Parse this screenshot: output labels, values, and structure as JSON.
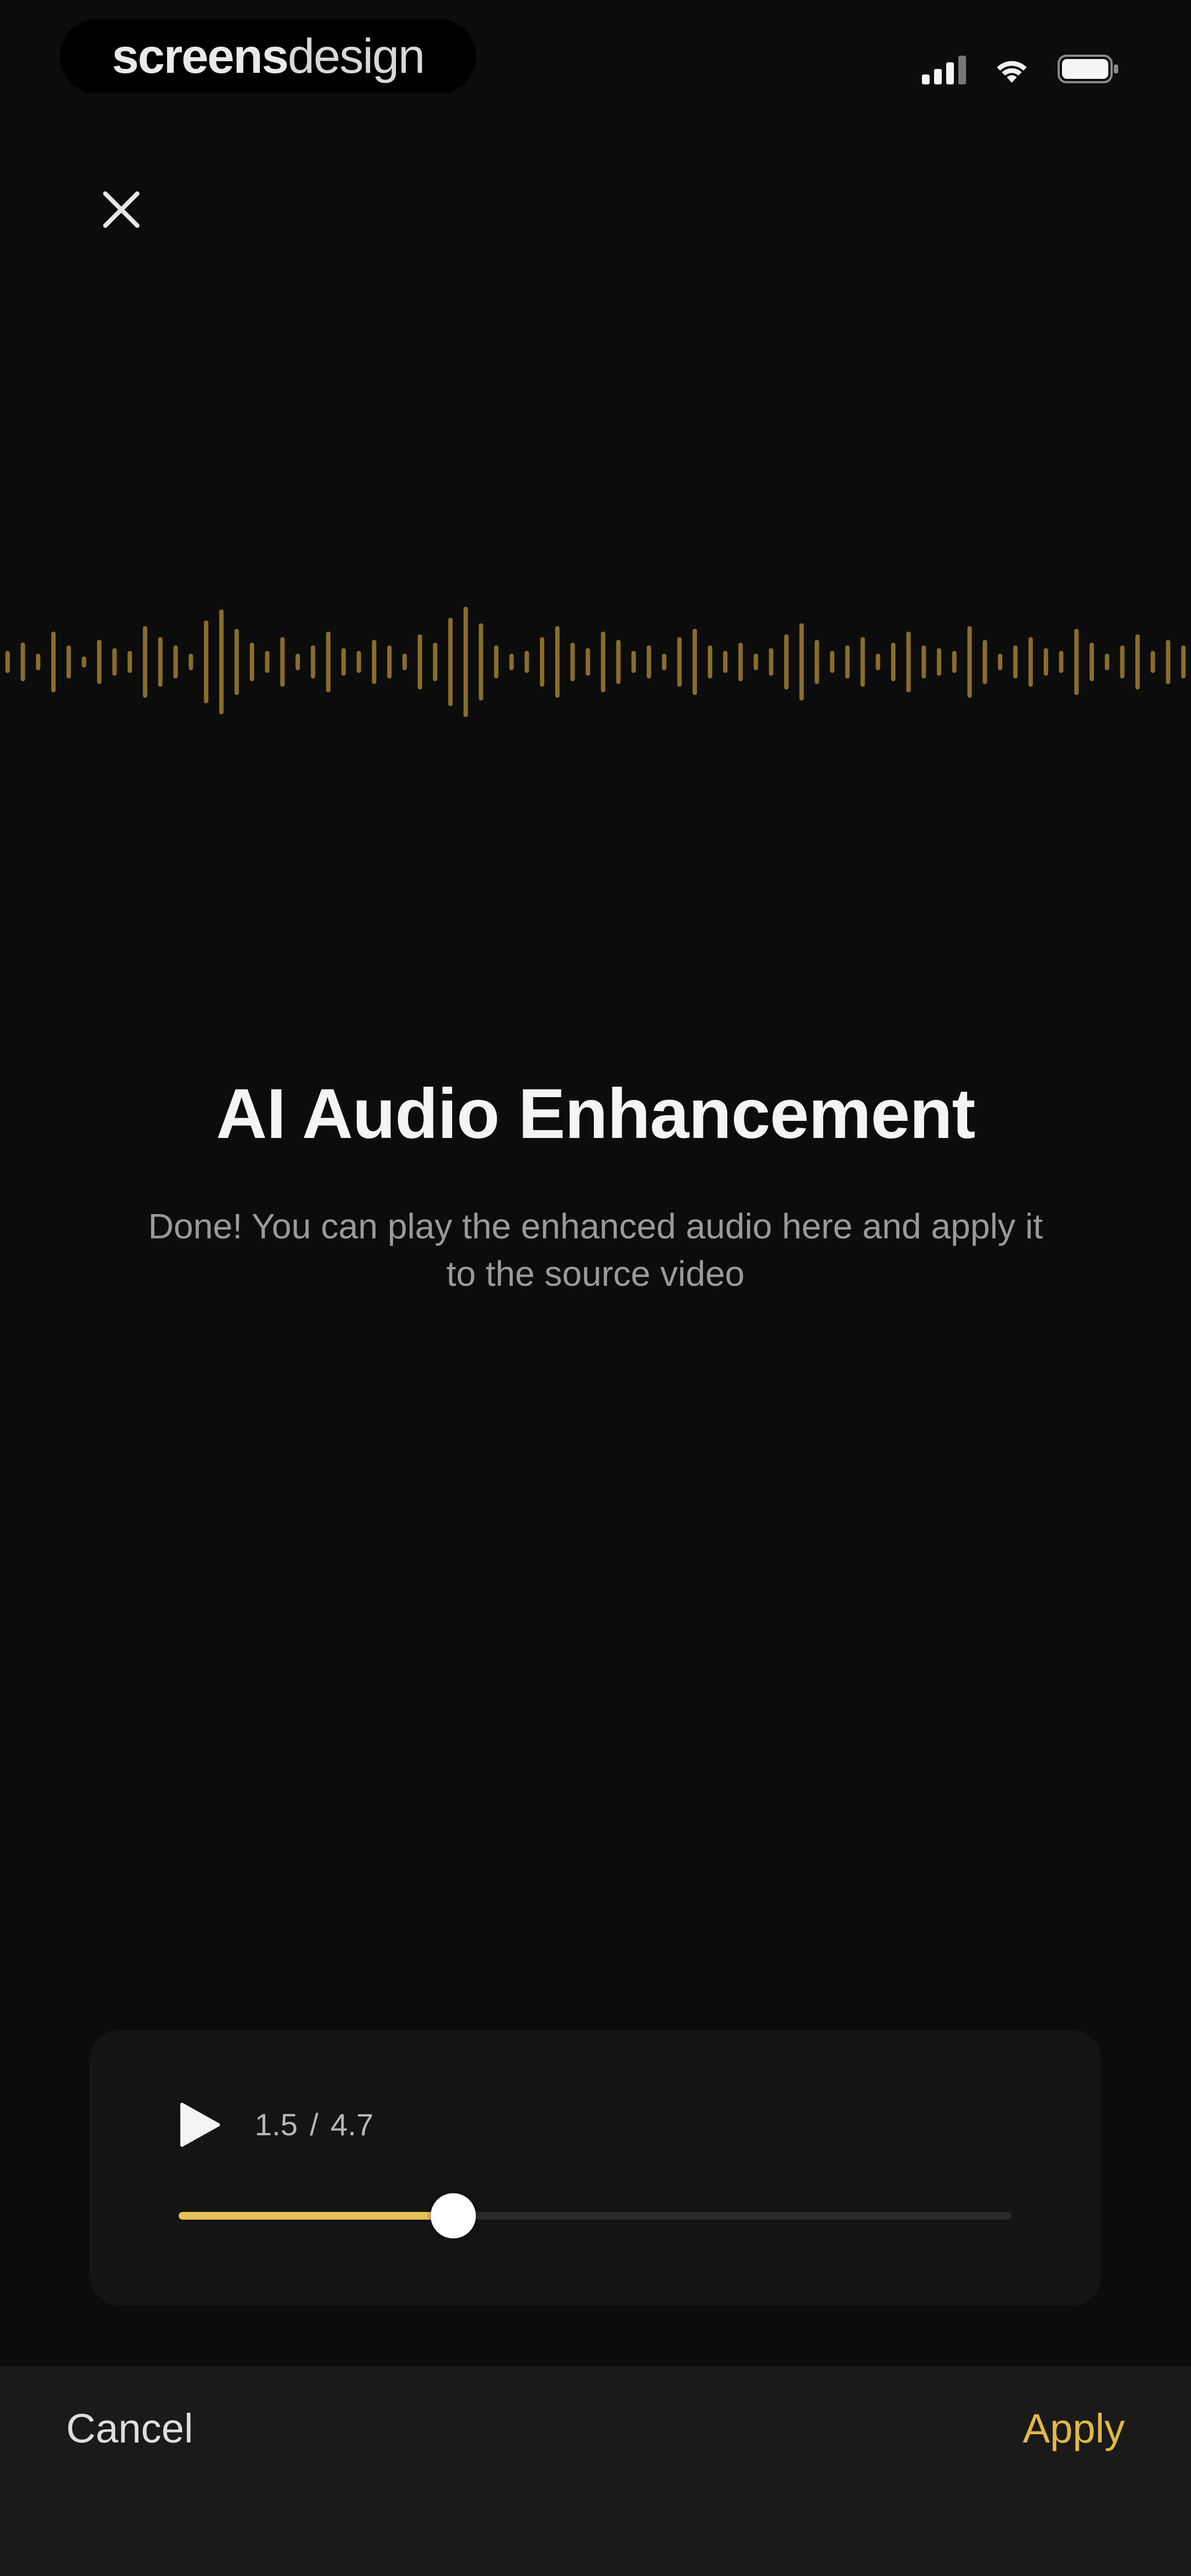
{
  "status_bar": {
    "brand_part1": "screens",
    "brand_part2": "design",
    "icons": [
      "signal-icon",
      "wifi-icon",
      "battery-icon"
    ]
  },
  "header": {
    "close_icon": "close-icon"
  },
  "waveform": {
    "color": "#8a6d2a"
  },
  "content": {
    "title": "AI Audio Enhancement",
    "subtitle": "Done! You can play the enhanced audio here and apply it to the source video"
  },
  "player": {
    "current_time": "1.5",
    "separator": "/",
    "total_time": "4.7",
    "progress": 0.33,
    "accent_color": "#e7c158",
    "play_icon": "play-icon"
  },
  "footer": {
    "cancel_label": "Cancel",
    "apply_label": "Apply",
    "apply_color": "#e2b845"
  }
}
